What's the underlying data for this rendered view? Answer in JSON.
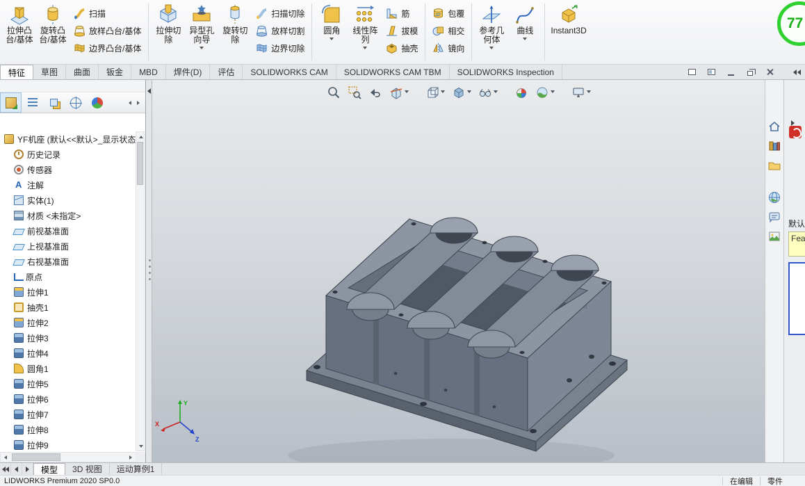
{
  "app": {
    "status_left": "LIDWORKS Premium 2020 SP0.0",
    "status_mode": "在编辑",
    "status_doc": "零件",
    "fps": "77"
  },
  "ribbon": {
    "extrude_boss": [
      "拉伸凸",
      "台/基体"
    ],
    "revolve_boss": [
      "旋转凸",
      "台/基体"
    ],
    "sweep": "扫描",
    "loft": "放样凸台/基体",
    "boundary": "边界凸台/基体",
    "extrude_cut": [
      "拉伸切",
      "除"
    ],
    "hole_wizard": [
      "异型孔",
      "向导"
    ],
    "revolve_cut": [
      "旋转切",
      "除"
    ],
    "swept_cut": "扫描切除",
    "lofted_cut": "放样切割",
    "boundary_cut": "边界切除",
    "fillet": [
      "圆角",
      ""
    ],
    "linear_pattern": [
      "线性阵",
      "列"
    ],
    "rib": "筋",
    "draft": "拔模",
    "shell": "抽壳",
    "wrap": "包覆",
    "intersect": "相交",
    "mirror": "镜向",
    "ref_geometry": [
      "参考几",
      "何体"
    ],
    "curve": [
      "曲线",
      ""
    ],
    "instant3d": [
      "Instant3D",
      ""
    ]
  },
  "command_tabs": {
    "items": [
      {
        "label": "特征",
        "state": "active"
      },
      {
        "label": "草图",
        "state": "idle"
      },
      {
        "label": "曲面",
        "state": "idle"
      },
      {
        "label": "钣金",
        "state": "idle"
      },
      {
        "label": "MBD",
        "state": "idle"
      },
      {
        "label": "焊件(D)",
        "state": "idle"
      },
      {
        "label": "评估",
        "state": "idle"
      },
      {
        "label": "SOLIDWORKS CAM",
        "state": "idle"
      },
      {
        "label": "SOLIDWORKS CAM TBM",
        "state": "idle"
      },
      {
        "label": "SOLIDWORKS Inspection",
        "state": "idle"
      }
    ],
    "window_control_icons": [
      "window-float",
      "window-dock",
      "minimize",
      "restore",
      "close",
      "collapse-pane-chevron"
    ]
  },
  "fm_tabs": {
    "icons": [
      "featuremanager-tree",
      "propertymanager",
      "configuration-manager",
      "dimxpert-manager",
      "display-manager",
      "scroll-left",
      "scroll-right"
    ]
  },
  "tree": {
    "items": [
      {
        "label": "YF机座 (默认<<默认>_显示状态 ",
        "icon": "ic-part",
        "lvl": "lvl0"
      },
      {
        "label": "历史记录",
        "icon": "ic-history",
        "lvl": "lvl1"
      },
      {
        "label": "传感器",
        "icon": "ic-sensor",
        "lvl": "lvl1"
      },
      {
        "label": "注解",
        "icon": "ic-ann",
        "lvl": "lvl1"
      },
      {
        "label": "实体(1)",
        "icon": "ic-bodies",
        "lvl": "lvl1"
      },
      {
        "label": "材质 <未指定>",
        "icon": "ic-material",
        "lvl": "lvl1"
      },
      {
        "label": "前视基准面",
        "icon": "ic-plane",
        "lvl": "lvl1"
      },
      {
        "label": "上视基准面",
        "icon": "ic-plane",
        "lvl": "lvl1"
      },
      {
        "label": "右视基准面",
        "icon": "ic-plane",
        "lvl": "lvl1"
      },
      {
        "label": "原点",
        "icon": "ic-origin",
        "lvl": "lvl1"
      },
      {
        "label": "拉伸1",
        "icon": "ic-extrude",
        "lvl": "lvl1"
      },
      {
        "label": "抽壳1",
        "icon": "ic-shell",
        "lvl": "lvl1"
      },
      {
        "label": "拉伸2",
        "icon": "ic-extrude",
        "lvl": "lvl1"
      },
      {
        "label": "拉伸3",
        "icon": "ic-extrude-cut",
        "lvl": "lvl1"
      },
      {
        "label": "拉伸4",
        "icon": "ic-extrude-cut",
        "lvl": "lvl1"
      },
      {
        "label": "圆角1",
        "icon": "ic-fillet",
        "lvl": "lvl1"
      },
      {
        "label": "拉伸5",
        "icon": "ic-extrude-cut",
        "lvl": "lvl1"
      },
      {
        "label": "拉伸6",
        "icon": "ic-extrude-cut",
        "lvl": "lvl1"
      },
      {
        "label": "拉伸7",
        "icon": "ic-extrude-cut",
        "lvl": "lvl1"
      },
      {
        "label": "拉伸8",
        "icon": "ic-extrude-cut",
        "lvl": "lvl1"
      },
      {
        "label": "拉伸9",
        "icon": "ic-extrude-cut",
        "lvl": "lvl1"
      }
    ]
  },
  "hud": {
    "icons": [
      "zoom-fit",
      "zoom-to-area",
      "previous-view",
      "section-view",
      "view-orientation",
      "display-style",
      "hide-show-items",
      "edit-appearance",
      "apply-scene",
      "view-settings"
    ]
  },
  "task_strip": {
    "icons": [
      "home",
      "design-library",
      "file-explorer",
      "view-palette",
      "forum",
      "appearances"
    ]
  },
  "task_edge": {
    "default_label": "默认",
    "fea_label": "Fea"
  },
  "viewport": {
    "triad": {
      "x": "X",
      "y": "Y",
      "z": "Z"
    }
  },
  "bottom_tabs": {
    "items": [
      {
        "label": "模型",
        "state": "active"
      },
      {
        "label": "3D 视图",
        "state": "idle"
      },
      {
        "label": "运动算例1",
        "state": "idle"
      }
    ]
  }
}
